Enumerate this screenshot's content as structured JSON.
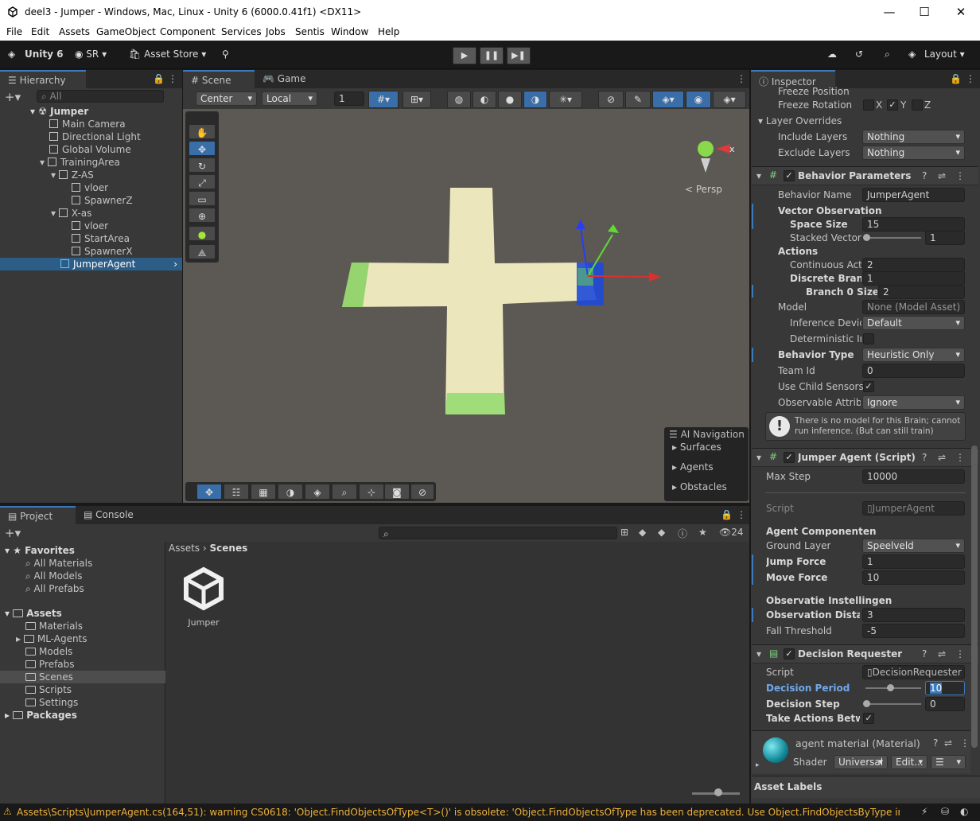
{
  "window": {
    "title": "deel3 - Jumper - Windows, Mac, Linux - Unity 6 (6000.0.41f1) <DX11>"
  },
  "menu": [
    "File",
    "Edit",
    "Assets",
    "GameObject",
    "Component",
    "Services",
    "Jobs",
    "Sentis",
    "Window",
    "Help"
  ],
  "toolbar": {
    "unity": "Unity 6",
    "account": "SR",
    "asset_store": "Asset Store",
    "layout": "Layout"
  },
  "hierarchy": {
    "tab": "Hierarchy",
    "search_placeholder": "All",
    "scene": "Jumper",
    "items": [
      "Main Camera",
      "Directional Light",
      "Global Volume",
      "TrainingArea",
      "Z-AS",
      "vloer",
      "SpawnerZ",
      "X-as",
      "vloer",
      "StartArea",
      "SpawnerX",
      "JumperAgent"
    ]
  },
  "scene": {
    "tab_scene": "Scene",
    "tab_game": "Game",
    "pivot": "Center",
    "space": "Local",
    "snap": "1",
    "persp": "< Persp",
    "ai_nav": {
      "title": "AI Navigation",
      "items": [
        "Surfaces",
        "Agents",
        "Obstacles"
      ]
    }
  },
  "project": {
    "tab_project": "Project",
    "tab_console": "Console",
    "count": "24",
    "favorites": "Favorites",
    "fav_items": [
      "All Materials",
      "All Models",
      "All Prefabs"
    ],
    "assets": "Assets",
    "asset_items": [
      "Materials",
      "ML-Agents",
      "Models",
      "Prefabs",
      "Scenes",
      "Scripts",
      "Settings"
    ],
    "packages": "Packages",
    "breadcrumb_root": "Assets",
    "breadcrumb_current": "Scenes",
    "file": "Jumper"
  },
  "inspector": {
    "tab": "Inspector",
    "freeze_position": "Freeze Position",
    "freeze_rotation": "Freeze Rotation",
    "x": "X",
    "y": "Y",
    "z": "Z",
    "layer_overrides": "Layer Overrides",
    "include_layers": "Include Layers",
    "include_val": "Nothing",
    "exclude_layers": "Exclude Layers",
    "exclude_val": "Nothing",
    "bp": {
      "title": "Behavior Parameters",
      "behavior_name_l": "Behavior Name",
      "behavior_name": "JumperAgent",
      "vector_obs": "Vector Observation",
      "space_size_l": "Space Size",
      "space_size": "15",
      "stacked_l": "Stacked Vectors",
      "stacked": "1",
      "actions": "Actions",
      "continuous_l": "Continuous Actions",
      "continuous": "2",
      "discrete_l": "Discrete Branches",
      "discrete": "1",
      "branch0_l": "Branch 0 Size",
      "branch0": "2",
      "model_l": "Model",
      "model": "None (Model Asset)",
      "inference_l": "Inference Device",
      "inference": "Default",
      "deterministic_l": "Deterministic Inference",
      "behavior_type_l": "Behavior Type",
      "behavior_type": "Heuristic Only",
      "team_l": "Team Id",
      "team": "0",
      "child_l": "Use Child Sensors",
      "observable_l": "Observable Attribute Handling",
      "observable": "Ignore",
      "warning": "There is no model for this Brain; cannot run inference. (But can still train)"
    },
    "ja": {
      "title": "Jumper Agent (Script)",
      "max_step_l": "Max Step",
      "max_step": "10000",
      "script_l": "Script",
      "script": "JumperAgent",
      "comp": "Agent Componenten",
      "ground_l": "Ground Layer",
      "ground": "Speelveld",
      "jump_l": "Jump Force",
      "jump": "1",
      "move_l": "Move Force",
      "move": "10",
      "obs": "Observatie Instellingen",
      "obs_dist_l": "Observation Distance",
      "obs_dist": "3",
      "fall_l": "Fall Threshold",
      "fall": "-5"
    },
    "dr": {
      "title": "Decision Requester",
      "script_l": "Script",
      "script": "DecisionRequester",
      "period_l": "Decision Period",
      "period": "10",
      "step_l": "Decision Step",
      "step": "0",
      "take_l": "Take Actions Between Decisions"
    },
    "mat": {
      "title": "agent material (Material)",
      "shader_l": "Shader",
      "shader": "Universal",
      "edit": "Edit..."
    },
    "asset_labels": "Asset Labels"
  },
  "status": {
    "message": "Assets\\Scripts\\JumperAgent.cs(164,51): warning CS0618: 'Object.FindObjectsOfType<T>()' is obsolete: 'Object.FindObjectsOfType has been deprecated. Use Object.FindObjectsByType instead w"
  }
}
